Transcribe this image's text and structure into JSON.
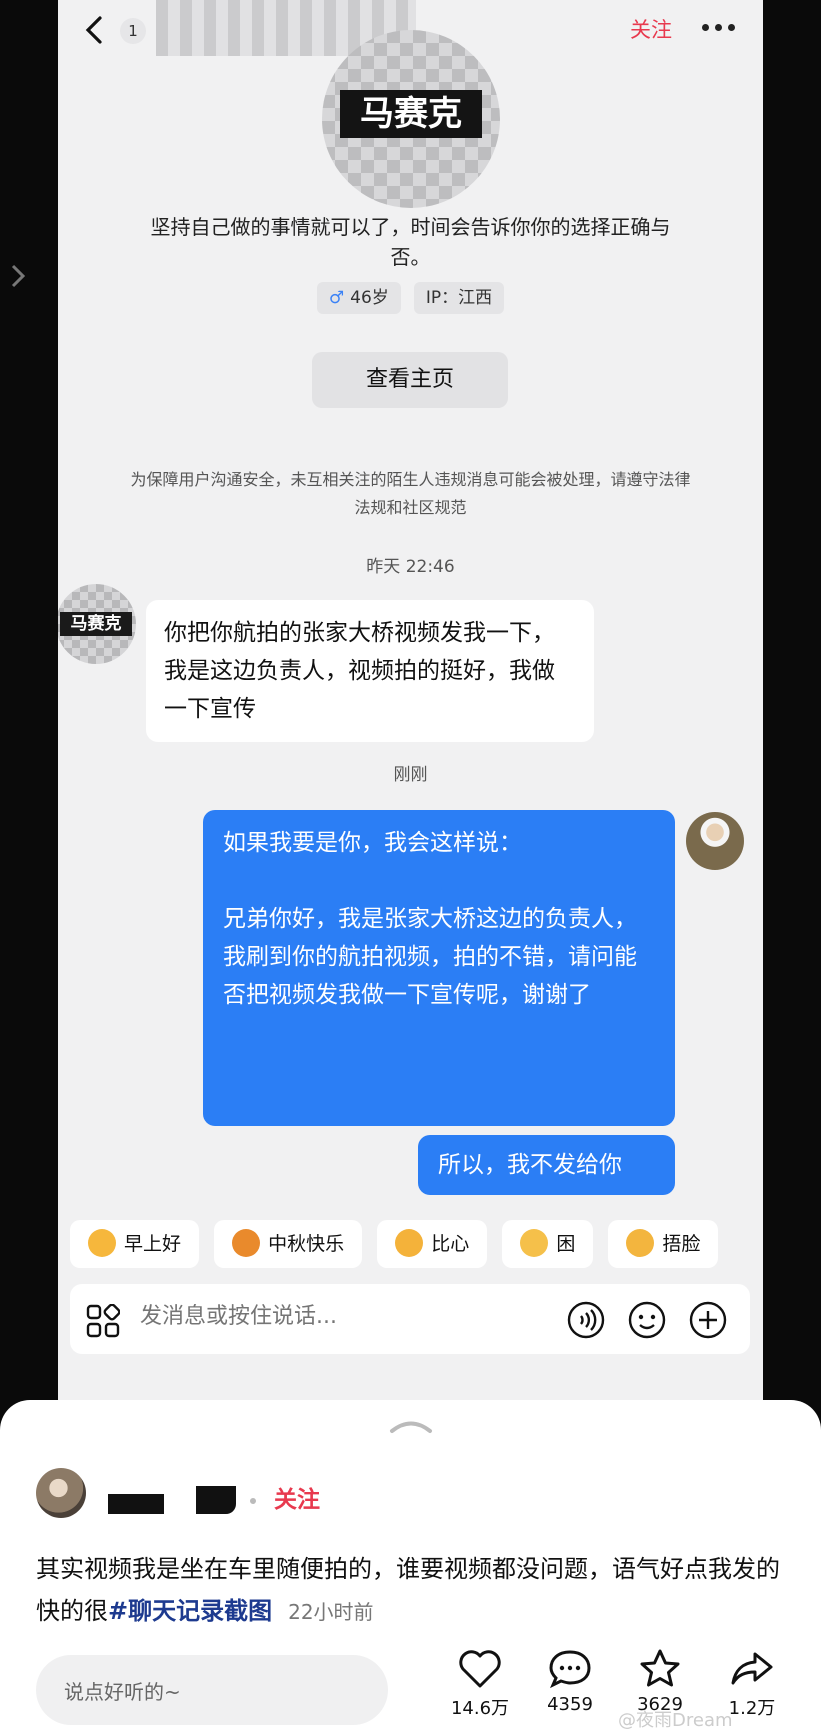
{
  "header": {
    "badge_count": "1",
    "follow_label": "关注"
  },
  "profile": {
    "avatar_text": "马赛克",
    "bio": "坚持自己做的事情就可以了，时间会告诉你你的选择正确与否。",
    "gender_symbol": "♂",
    "age": "46岁",
    "ip": "IP：江西",
    "home_button": "查看主页"
  },
  "notice": "为保障用户沟通安全，未互相关注的陌生人违规消息可能会被处理，请遵守法律法规和社区规范",
  "messages": {
    "time_1": "昨天 22:46",
    "incoming_avatar_text": "马赛克",
    "incoming": "你把你航拍的张家大桥视频发我一下，我是这边负责人，视频拍的挺好，我做一下宣传",
    "time_2": "刚刚",
    "outgoing_1_line1": "如果我要是你，我会这样说：",
    "outgoing_1_line2": "兄弟你好，我是张家大桥这边的负责人，我刷到你的航拍视频，拍的不错，请问能否把视频发我做一下宣传呢，谢谢了",
    "outgoing_2": "所以，我不发给你"
  },
  "quick_replies": [
    {
      "label": "早上好",
      "color": "#f6b73c"
    },
    {
      "label": "中秋快乐",
      "color": "#e98a2c"
    },
    {
      "label": "比心",
      "color": "#f4b23a"
    },
    {
      "label": "困",
      "color": "#f5c04a"
    },
    {
      "label": "捂脸",
      "color": "#f3b53e"
    }
  ],
  "input": {
    "placeholder": "发消息或按住说话..."
  },
  "post": {
    "follow_label": "关注",
    "text": "其实视频我是坐在车里随便拍的，谁要视频都没问题，语气好点我发的快的很",
    "tag": "#聊天记录截图",
    "time": "22小时前",
    "comment_placeholder": "说点好听的~",
    "likes": "14.6万",
    "comments": "4359",
    "favorites": "3629",
    "shares": "1.2万",
    "watermark": "@夜雨Dream"
  },
  "colors": {
    "accent_red": "#e8394e",
    "bubble_blue": "#2b7ef5",
    "tag_blue": "#1d3a8f"
  }
}
